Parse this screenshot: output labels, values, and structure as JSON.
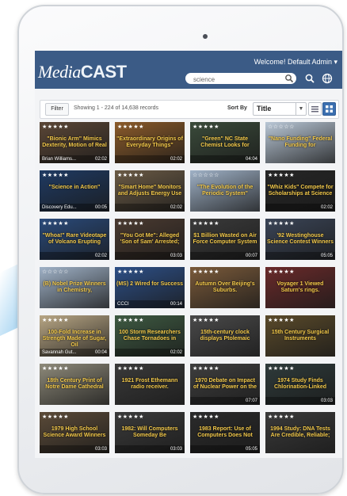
{
  "header": {
    "logo_prefix": "Media",
    "logo_suffix": "CAST",
    "welcome": "Welcome! Default Admin ▾"
  },
  "search": {
    "value": "science"
  },
  "filterbar": {
    "filter_label": "Filter",
    "showing": "Showing 1 - 224 of 14,638 records",
    "sort_label": "Sort By",
    "sort_value": "Title"
  },
  "colors": {
    "header": "#3b5b86",
    "title_text": "#f3c94a"
  },
  "tiles": [
    {
      "stars": "★★★★★",
      "title": "\"Bionic Arm\" Mimics Dexterity, Motion of Real",
      "source": "Brian Williams...",
      "duration": "02:02",
      "bg": "#5a4636"
    },
    {
      "stars": "★★★★★",
      "title": "\"Extraordinary Origins of Everyday Things\"",
      "source": "",
      "duration": "02:02",
      "bg": "#8a5a2a"
    },
    {
      "stars": "★★★★★",
      "title": "\"Green\" NC State Chemist Looks for",
      "source": "",
      "duration": "04:04",
      "bg": "#3a4a3a"
    },
    {
      "stars": "☆☆☆☆☆",
      "title": "\"Nano Funding\" Federal Funding for",
      "source": "",
      "duration": "",
      "bg": "#b9c7d6"
    },
    {
      "stars": "★★★★★",
      "title": "\"Science in Action\"",
      "source": "Discovery Edu...",
      "duration": "00:05",
      "bg": "#1f3a62"
    },
    {
      "stars": "★★★★★",
      "title": "\"Smart Home\" Monitors and Adjusts Energy Use",
      "source": "",
      "duration": "02:02",
      "bg": "#6a5a45"
    },
    {
      "stars": "☆☆☆☆☆",
      "title": "\"The Evolution of the Periodic System\"",
      "source": "",
      "duration": "",
      "bg": "#9fb1c6"
    },
    {
      "stars": "★★★★★",
      "title": "\"Whiz Kids\" Compete for Scholarships at Science",
      "source": "",
      "duration": "02:02",
      "bg": "#262626"
    },
    {
      "stars": "★★★★★",
      "title": "\"Whoa!\" Rare Videotape of Volcano Erupting",
      "source": "",
      "duration": "02:02",
      "bg": "#2a4a7a"
    },
    {
      "stars": "★★★★★",
      "title": "\"You Got Me\": Alleged 'Son of Sam' Arrested;",
      "source": "",
      "duration": "03:03",
      "bg": "#4a3a30"
    },
    {
      "stars": "★★★★★",
      "title": "$1 Billion Wasted on Air Force Computer System",
      "source": "",
      "duration": "00:07",
      "bg": "#3a3a3a"
    },
    {
      "stars": "★★★★★",
      "title": "'92 Westinghouse Science Contest Winners",
      "source": "",
      "duration": "05:05",
      "bg": "#3a4456"
    },
    {
      "stars": "☆☆☆☆☆",
      "title": "(B) Nobel Prize Winners in Chemistry,",
      "source": "",
      "duration": "",
      "bg": "#9fb1c6"
    },
    {
      "stars": "★★★★★",
      "title": "(MS) 2 Wired for Success",
      "source": "CCCI",
      "duration": "00:14",
      "bg": "#2d4f86"
    },
    {
      "stars": "★★★★★",
      "title": "Autumn Over Beijing's Suburbs.",
      "source": "",
      "duration": "",
      "bg": "#7a5a3a"
    },
    {
      "stars": "★★★★★",
      "title": "Voyager 1 Viewed Saturn's rings.",
      "source": "",
      "duration": "",
      "bg": "#6a2a2a"
    },
    {
      "stars": "★★★★★",
      "title": "100-Fold Increase in Strength Made of Sugar, Oil",
      "source": "Savannah Gut...",
      "duration": "00:04",
      "bg": "#b8a684"
    },
    {
      "stars": "★★★★★",
      "title": "100 Storm Researchers Chase Tornadoes in",
      "source": "",
      "duration": "02:02",
      "bg": "#3e5a42"
    },
    {
      "stars": "★★★★★",
      "title": "15th-century clock displays Ptolemaic",
      "source": "",
      "duration": "",
      "bg": "#4a4a4a"
    },
    {
      "stars": "★★★★★",
      "title": "15th Century Surgical Instruments",
      "source": "",
      "duration": "",
      "bg": "#5a4a2a"
    },
    {
      "stars": "★★★★★",
      "title": "18th Century Print of Notre Dame Cathedral",
      "source": "",
      "duration": "",
      "bg": "#8e8a7a"
    },
    {
      "stars": "★★★★★",
      "title": "1921 Frost Ethemann radio receiver.",
      "source": "",
      "duration": "",
      "bg": "#3a3a3a"
    },
    {
      "stars": "★★★★★",
      "title": "1970 Debate on Impact of Nuclear Power on the",
      "source": "",
      "duration": "07:07",
      "bg": "#3e3e3e"
    },
    {
      "stars": "★★★★★",
      "title": "1974 Study Finds Chlorination-Linked",
      "source": "",
      "duration": "03:03",
      "bg": "#2e3a3a"
    },
    {
      "stars": "★★★★★",
      "title": "1979 High School Science Award Winners",
      "source": "",
      "duration": "03:03",
      "bg": "#5a4a38"
    },
    {
      "stars": "★★★★★",
      "title": "1982: Will Computers Someday Be",
      "source": "",
      "duration": "03:03",
      "bg": "#3a3a3a"
    },
    {
      "stars": "★★★★★",
      "title": "1983 Report: Use of Computers Does Not",
      "source": "",
      "duration": "05:05",
      "bg": "#2a2a2a"
    },
    {
      "stars": "★★★★★",
      "title": "1994 Study: DNA Tests Are Credible, Reliable;",
      "source": "",
      "duration": "",
      "bg": "#3a3a3a"
    }
  ]
}
